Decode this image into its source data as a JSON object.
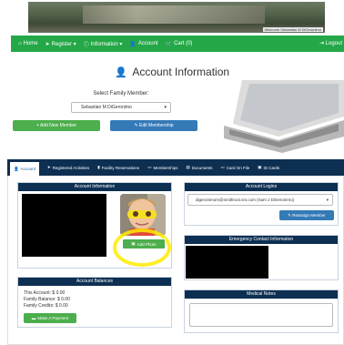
{
  "banner": {
    "welcome_text": "Welcome Sebastian M DiGeronimo"
  },
  "nav": {
    "items": [
      {
        "icon": "home-icon",
        "label": "Home"
      },
      {
        "icon": "send-icon",
        "label": "Register ▾"
      },
      {
        "icon": "info-icon",
        "label": "Information ▾"
      },
      {
        "icon": "user-icon",
        "label": "Account"
      },
      {
        "icon": "cart-icon",
        "label": "Cart (0)"
      }
    ],
    "logout_label": "Logout"
  },
  "page": {
    "title": "Account Information",
    "title_icon": "user-icon"
  },
  "family": {
    "select_label": "Select Family Member:",
    "selected_member": "Sebastian M DiGeronimo",
    "add_member_label": "+ Add New Member",
    "edit_membership_label": "✎ Edit Membership"
  },
  "tabs": [
    {
      "icon": "user-icon",
      "label": "Account",
      "active": true
    },
    {
      "icon": "send-icon",
      "label": "Registered Activities",
      "active": false
    },
    {
      "icon": "bookmark-icon",
      "label": "Facility Reservations",
      "active": false
    },
    {
      "icon": "card-icon",
      "label": "Memberships",
      "active": false
    },
    {
      "icon": "document-icon",
      "label": "Documents",
      "active": false
    },
    {
      "icon": "card-icon",
      "label": "Card On File",
      "active": false
    },
    {
      "icon": "id-card-icon",
      "label": "ID Cards",
      "active": false
    }
  ],
  "account_info": {
    "heading": "Account Information",
    "add_photo_label": "Add Photo"
  },
  "account_logins": {
    "heading": "Account Logins",
    "selected_login": "digeronimom@smithrust.sm.com (Sam J DiGeronimo)",
    "reassign_label": "✎ Reassign Member"
  },
  "emergency": {
    "heading": "Emergency Contact Information"
  },
  "balances": {
    "heading": "Account Balances",
    "this_account": "This Account: $ 0.00",
    "family_balance": "Family Balance: $ 0.00",
    "family_credits": "Family Credits: $ 0.00",
    "make_payment_label": "Make A Payment"
  },
  "medical": {
    "heading": "Medical Notes"
  },
  "colors": {
    "nav_green": "#24a847",
    "navy": "#0d2f52",
    "button_green": "#4cae4c",
    "button_blue": "#337ab7",
    "highlight_yellow": "#ffeb00"
  }
}
